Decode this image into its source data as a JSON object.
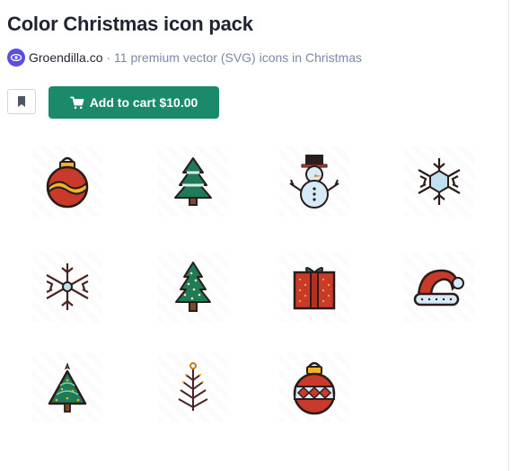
{
  "header": {
    "title": "Color Christmas icon pack",
    "author": "Groendilla.co",
    "description": "· 11 premium vector (SVG) icons in Christmas"
  },
  "actions": {
    "bookmark_icon": "bookmark-icon",
    "cart_icon": "cart-icon",
    "cart_label": "Add to cart $10.00"
  },
  "icons": [
    "ornament-ball-icon",
    "christmas-tree-snowy-icon",
    "snowman-icon",
    "snowflake-icon",
    "snowflake-simple-icon",
    "christmas-tree-lights-icon",
    "gift-box-icon",
    "santa-hat-icon",
    "triangle-tree-icon",
    "bare-tree-icon",
    "ornament-ball-striped-icon"
  ],
  "colors": {
    "accent": "#1b8a6b",
    "avatar": "#5b4fe0",
    "muted_text": "#7a8aa6",
    "title_text": "#1f2430"
  }
}
